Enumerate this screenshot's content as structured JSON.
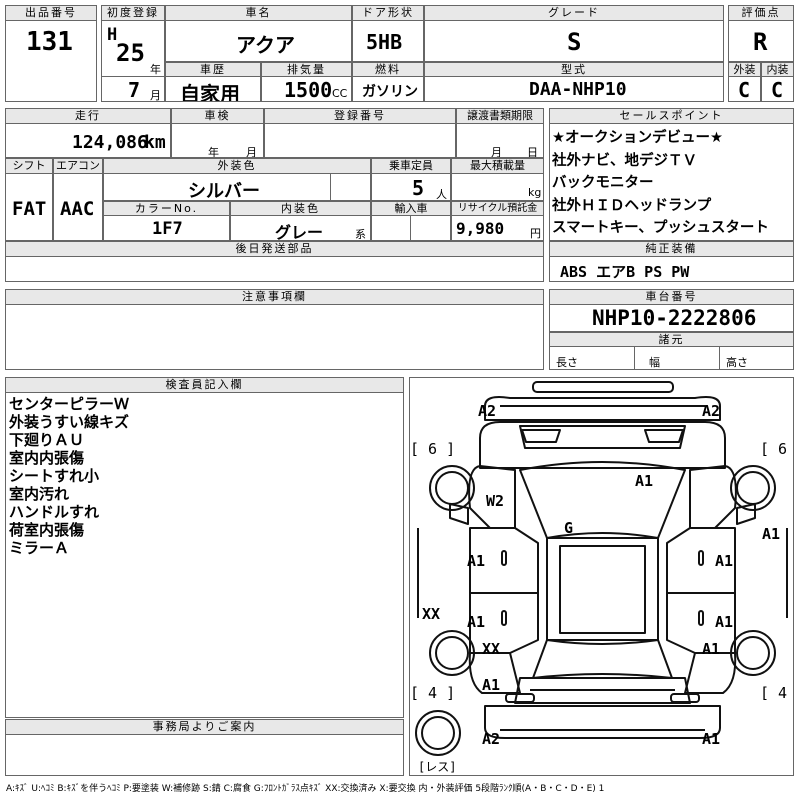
{
  "header": {
    "lot_label": "出品番号",
    "lot_value": "131",
    "first_reg_label": "初度登録",
    "era": "H",
    "year": "25",
    "year_unit": "年",
    "month": "7",
    "month_unit": "月",
    "car_name_label": "車名",
    "car_name": "アクア",
    "door_label": "ドア形状",
    "door": "5HB",
    "grade_label": "グレード",
    "grade": "S",
    "score_label": "評価点",
    "score": "R",
    "history_label": "車歴",
    "history": "自家用",
    "displacement_label": "排気量",
    "displacement": "1500",
    "cc": "CC",
    "fuel_label": "燃料",
    "fuel": "ガソリン",
    "model_label": "型式",
    "model": "DAA-NHP10",
    "ext_label": "外装",
    "ext": "C",
    "int_label": "内装",
    "int": "C"
  },
  "row2": {
    "mileage_label": "走行",
    "mileage": "124,086",
    "km": "km",
    "inspection_label": "車検",
    "ins_year": "年",
    "ins_month": "月",
    "reg_no_label": "登録番号",
    "transfer_label": "譲渡書類期限",
    "tr_month": "月",
    "tr_day": "日",
    "shift_label": "シフト",
    "shift": "FAT",
    "ac_label": "エアコン",
    "ac": "AAC",
    "color_label": "外装色",
    "color": "シルバー",
    "capacity_label": "乗車定員",
    "capacity": "5",
    "person": "人",
    "load_label": "最大積載量",
    "kg": "kg",
    "color_no_label": "カラーNo.",
    "color_no": "1F7",
    "interior_color_label": "内装色",
    "interior_color": "グレー",
    "kei": "系",
    "import_label": "輸入車",
    "recycle_label": "リサイクル預託金",
    "recycle": "9,980",
    "yen": "円",
    "later_label": "後日発送部品"
  },
  "sales_points": {
    "label": "セールスポイント",
    "items": [
      "★オークションデビュー★",
      "社外ナビ、地デジＴＶ",
      "バックモニター",
      "社外ＨＩＤヘッドランプ",
      "スマートキー、プッシュスタート"
    ]
  },
  "equipment": {
    "label": "純正装備",
    "value": "ABS エアB PS PW"
  },
  "notes_label": "注意事項欄",
  "chassis": {
    "label": "車台番号",
    "value": "NHP10-2222806",
    "spec_label": "諸元",
    "length": "長さ",
    "width": "幅",
    "height": "高さ"
  },
  "inspector": {
    "label": "検査員記入欄",
    "lines": [
      "センターピラーＷ",
      "外装うすい線キズ",
      "下廻りＡＵ",
      "室内内張傷",
      "シートすれ小",
      "室内汚れ",
      "ハンドルすれ",
      "荷室内張傷",
      "ミラーＡ"
    ]
  },
  "office_label": "事務局よりご案内",
  "diagram": {
    "marks": [
      "A2",
      "A2",
      "[ 6 ]",
      "[ 6 ]",
      "A1",
      "W2",
      "G",
      "A1",
      "A1",
      "A1",
      "XX",
      "A1",
      "A1",
      "XX",
      "A1",
      "A1",
      "[ 4 ]",
      "[ 4 ]",
      "A2",
      "A1",
      "[レス]"
    ]
  },
  "legend": "A:ｷｽﾞ U:ﾍｺﾐ B:ｷｽﾞを伴うﾍｺﾐ P:要塗装 W:補修跡 S:錆 C:腐食 G:ﾌﾛﾝﾄｶﾞﾗｽ点ｷｽﾞ XX:交換済み X:要交換 内・外装評価 5段階ﾗﾝｸ順(A・B・C・D・E) 1"
}
